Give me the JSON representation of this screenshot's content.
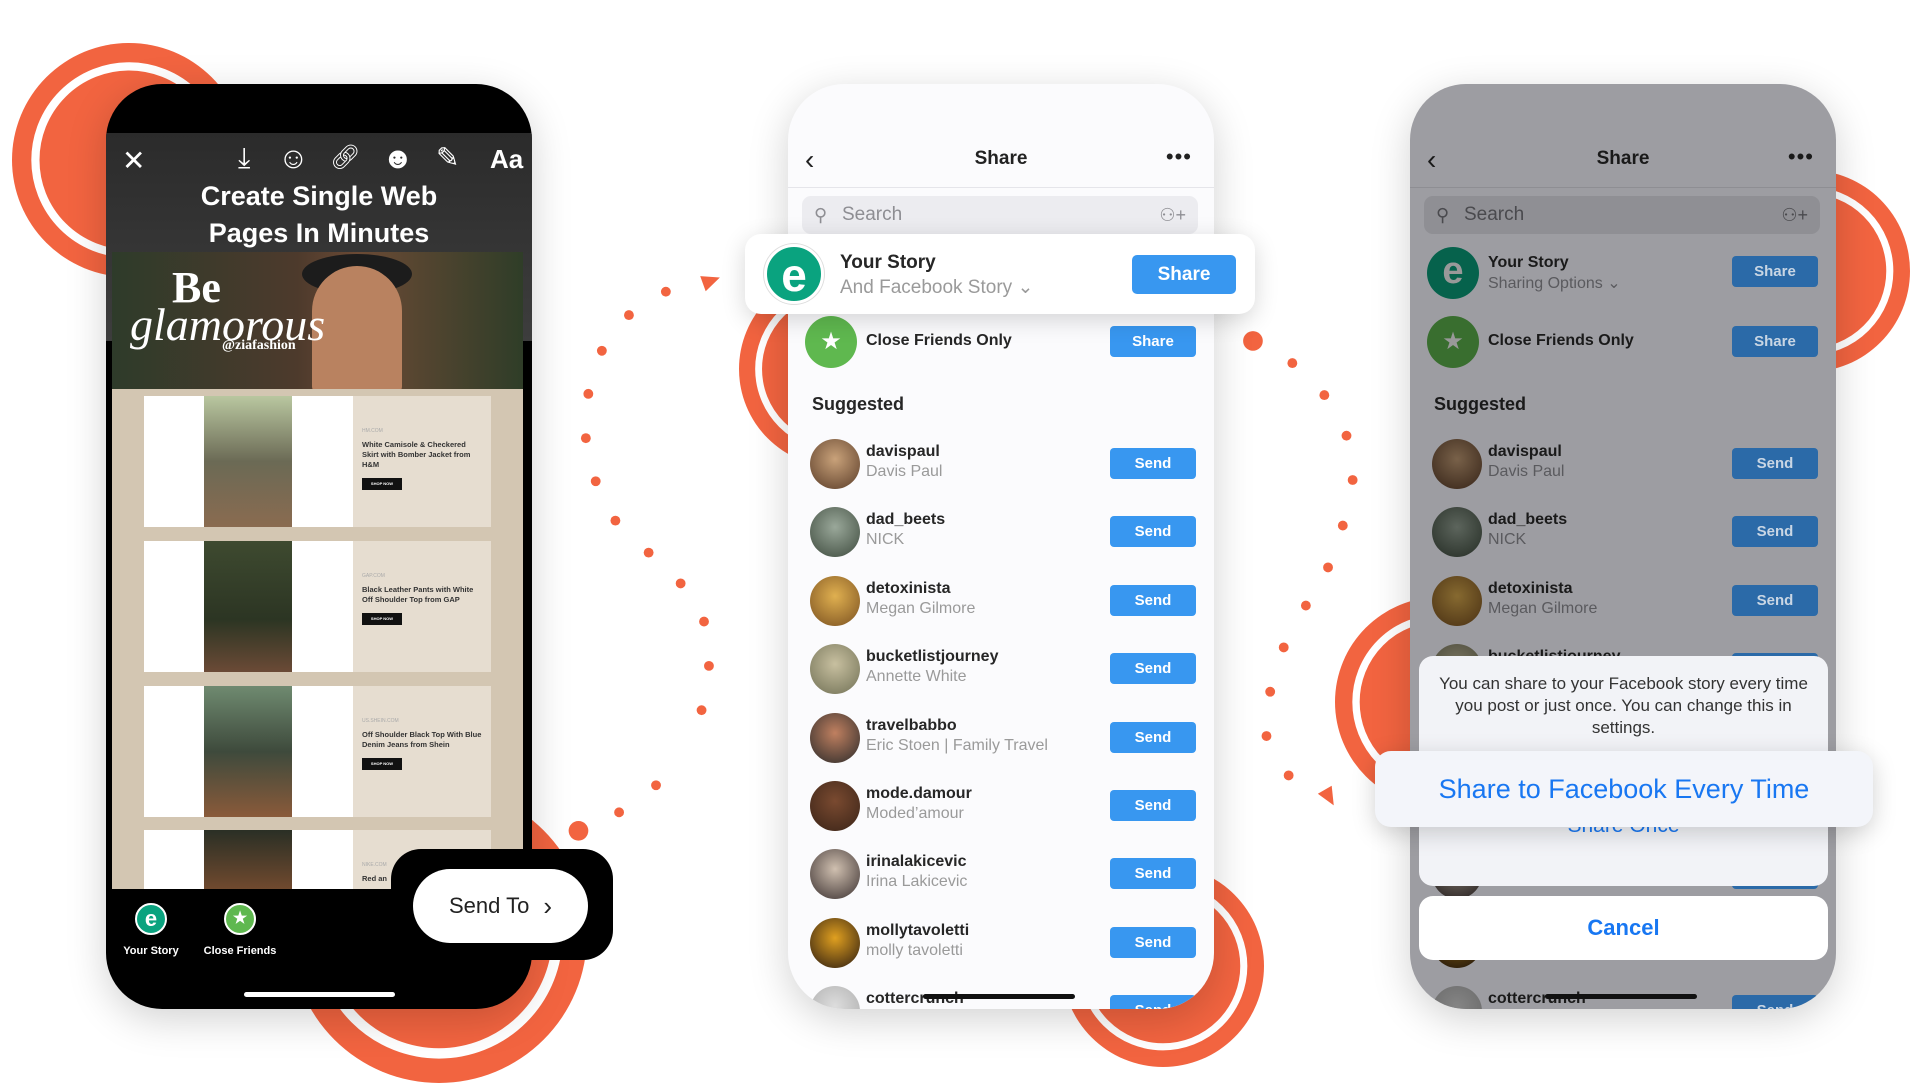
{
  "colors": {
    "accent": "#f26440",
    "button_blue": "#3897f0",
    "ios_blue": "#1877f2",
    "brand_green": "#0aa37f",
    "close_friends_green": "#5fb84f"
  },
  "editor": {
    "icons": [
      "close-icon",
      "download-icon",
      "sticker-face-icon",
      "link-icon",
      "sticker-icon",
      "draw-icon"
    ],
    "text_tool": "Aa",
    "title_line1": "Create Single Web",
    "title_line2": "Pages In Minutes",
    "banner": {
      "line1": "Be",
      "line2": "glamorous",
      "handle": "@ziafashion"
    },
    "cards": [
      {
        "source": "HM.COM",
        "title": "White Camisole & Checkered Skirt with Bomber Jacket from H&M",
        "button": "SHOP NOW"
      },
      {
        "source": "GAP.COM",
        "title": "Black Leather Pants with White Off Shoulder Top from GAP",
        "button": "SHOP NOW"
      },
      {
        "source": "US.SHEIN.COM",
        "title": "Off Shoulder Black Top With Blue Denim Jeans from Shein",
        "button": "SHOP NOW"
      },
      {
        "source": "NIKE.COM",
        "title": "Red an",
        "button": ""
      }
    ],
    "bottom": {
      "your_story": "Your Story",
      "close_friends": "Close Friends",
      "send_to": "Send To"
    }
  },
  "share": {
    "title": "Share",
    "search_placeholder": "Search",
    "your_story": {
      "title": "Your Story",
      "subtitle": "And Facebook Story",
      "button": "Share"
    },
    "your_story_dim": {
      "subtitle": "Sharing Options"
    },
    "close_friends": {
      "title": "Close Friends Only",
      "button": "Share"
    },
    "suggested_label": "Suggested",
    "send_label": "Send",
    "users": [
      {
        "username": "davispaul",
        "name": "Davis Paul"
      },
      {
        "username": "dad_beets",
        "name": "NICK"
      },
      {
        "username": "detoxinista",
        "name": "Megan Gilmore"
      },
      {
        "username": "bucketlistjourney",
        "name": "Annette White"
      },
      {
        "username": "travelbabbo",
        "name": "Eric Stoen | Family Travel"
      },
      {
        "username": "mode.damour",
        "name": "Moded’amour"
      },
      {
        "username": "irinalakicevic",
        "name": "Irina Lakicevic"
      },
      {
        "username": "mollytavoletti",
        "name": "molly tavoletti"
      },
      {
        "username": "cottercrunch",
        "name": ""
      }
    ]
  },
  "action_sheet": {
    "message": "You can share to your Facebook story every time you post or just once. You can change this in settings.",
    "option_every_time": "Share to Facebook Every Time",
    "option_once": "Share Once",
    "cancel": "Cancel"
  }
}
